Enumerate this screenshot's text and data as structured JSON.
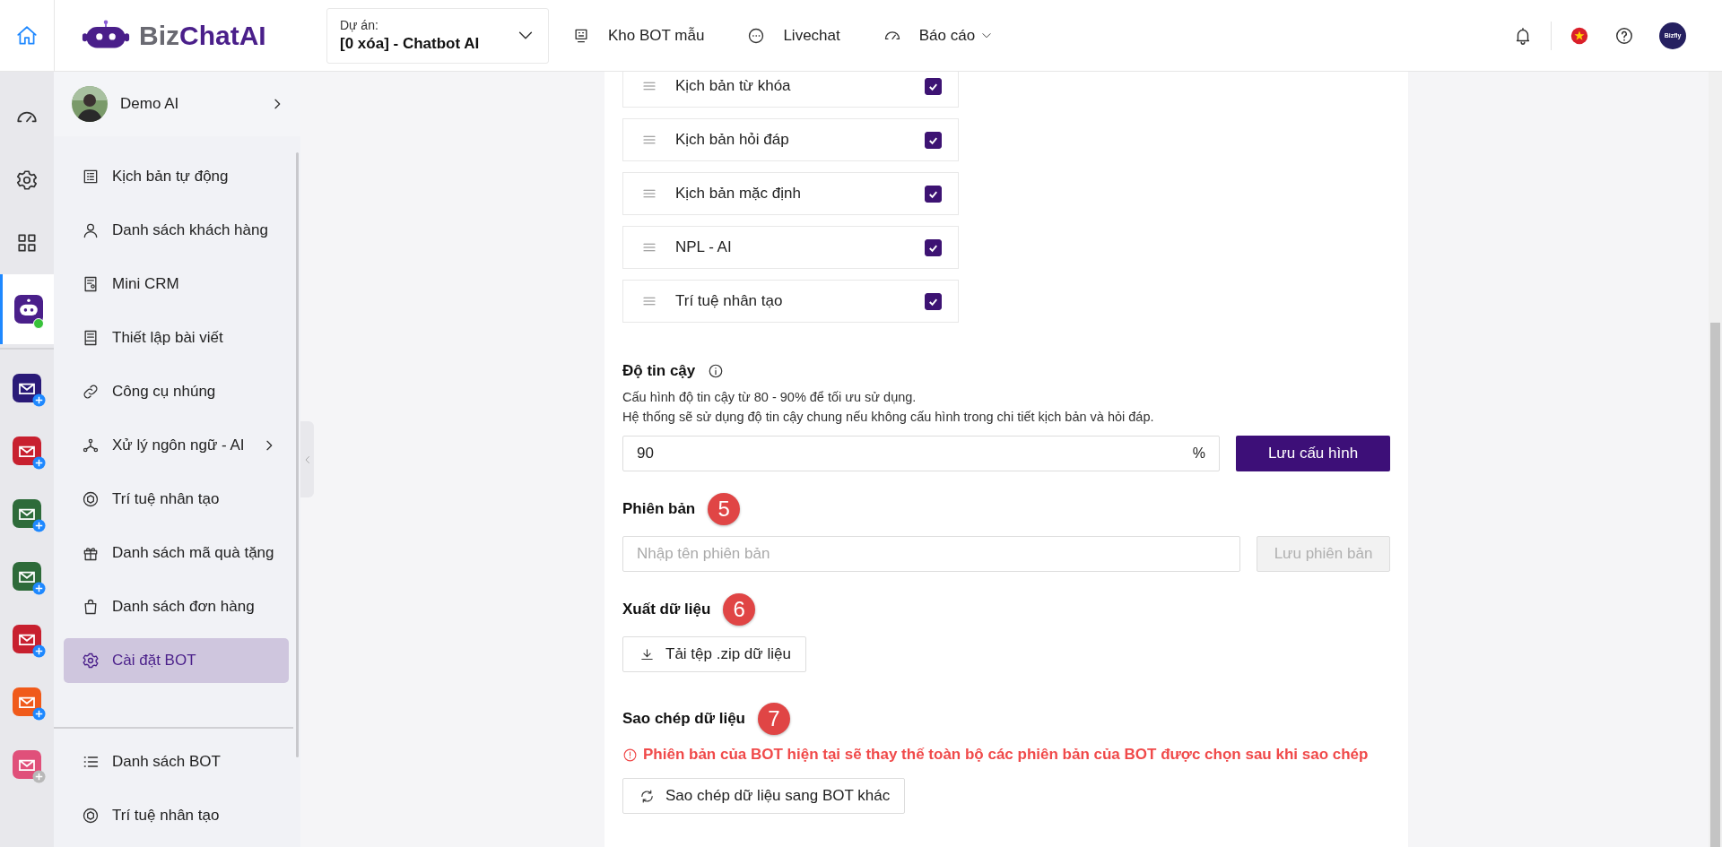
{
  "topbar": {
    "logo": {
      "brand": "Biz",
      "product": "ChatAI"
    },
    "project": {
      "label": "Dự án:",
      "value": "[0 xóa] - Chatbot AI"
    },
    "nav": [
      {
        "label": "Kho BOT mẫu",
        "kind": "bot",
        "dropdown": false
      },
      {
        "label": "Livechat",
        "kind": "chat",
        "dropdown": false
      },
      {
        "label": "Báo cáo",
        "kind": "gauge",
        "dropdown": true
      }
    ],
    "avatar_text": "Bizfly"
  },
  "rail": {
    "items": [
      {
        "kind": "gauge",
        "selected": false
      },
      {
        "kind": "gear",
        "selected": false
      },
      {
        "kind": "grid",
        "selected": false
      },
      {
        "kind": "bot",
        "selected": true
      }
    ],
    "apps": [
      {
        "color": "#2a1a78",
        "badge_active": true
      },
      {
        "color": "#c8202f",
        "badge_active": true
      },
      {
        "color": "#2e6b3a",
        "badge_active": true
      },
      {
        "color": "#2e6b3a",
        "badge_active": true
      },
      {
        "color": "#c8202f",
        "badge_active": true
      },
      {
        "color": "#f05a1a",
        "badge_active": true
      },
      {
        "color": "#e0507a",
        "badge_active": false
      }
    ]
  },
  "sidebar": {
    "profile": {
      "name": "Demo AI"
    },
    "items": [
      {
        "label": "Kịch bản tự động",
        "kind": "doclist",
        "selected": false,
        "submenu": false
      },
      {
        "label": "Danh sách khách hàng",
        "kind": "user",
        "selected": false,
        "submenu": false
      },
      {
        "label": "Mini CRM",
        "kind": "receipt",
        "selected": false,
        "submenu": false
      },
      {
        "label": "Thiết lập bài viết",
        "kind": "article",
        "selected": false,
        "submenu": false
      },
      {
        "label": "Công cụ nhúng",
        "kind": "link",
        "selected": false,
        "submenu": false
      },
      {
        "label": "Xử lý ngôn ngữ - AI",
        "kind": "nodes",
        "selected": false,
        "submenu": true
      },
      {
        "label": "Trí tuệ nhân tạo",
        "kind": "ai",
        "selected": false,
        "submenu": false
      },
      {
        "label": "Danh sách mã quà tặng",
        "kind": "gift",
        "selected": false,
        "submenu": false
      },
      {
        "label": "Danh sách đơn hàng",
        "kind": "bag",
        "selected": false,
        "submenu": false
      },
      {
        "label": "Cài đặt BOT",
        "kind": "gear",
        "selected": true,
        "submenu": false
      }
    ],
    "bottom_items": [
      {
        "label": "Danh sách BOT",
        "kind": "bullets",
        "selected": false
      },
      {
        "label": "Trí tuệ nhân tạo",
        "kind": "ai",
        "selected": false
      }
    ]
  },
  "modules": [
    {
      "label": "Kịch bản từ khóa",
      "checked": true
    },
    {
      "label": "Kịch bản hỏi đáp",
      "checked": true
    },
    {
      "label": "Kịch bản mặc định",
      "checked": true
    },
    {
      "label": "NPL - AI",
      "checked": true
    },
    {
      "label": "Trí tuệ nhân tạo",
      "checked": true
    }
  ],
  "confidence": {
    "title": "Độ tin cậy",
    "lines": [
      "Cấu hình độ tin cậy từ 80 - 90% để tối ưu sử dụng.",
      "Hệ thống sẽ sử dụng độ tin cậy chung nếu không cấu hình trong chi tiết kịch bản và hỏi đáp."
    ],
    "value": "90",
    "unit": "%",
    "button": "Lưu cấu hình"
  },
  "version": {
    "title": "Phiên bản",
    "marker": "5",
    "placeholder": "Nhập tên phiên bản",
    "button": "Lưu phiên bản",
    "button_disabled": true
  },
  "export": {
    "title": "Xuất dữ liệu",
    "marker": "6",
    "button": "Tải tệp .zip dữ liệu"
  },
  "copy": {
    "title": "Sao chép dữ liệu",
    "marker": "7",
    "warning": "Phiên bản của BOT hiện tại sẽ thay thế toàn bộ các phiên bản của BOT được chọn sau khi sao chép",
    "button": "Sao chép dữ liệu sang BOT khác"
  }
}
